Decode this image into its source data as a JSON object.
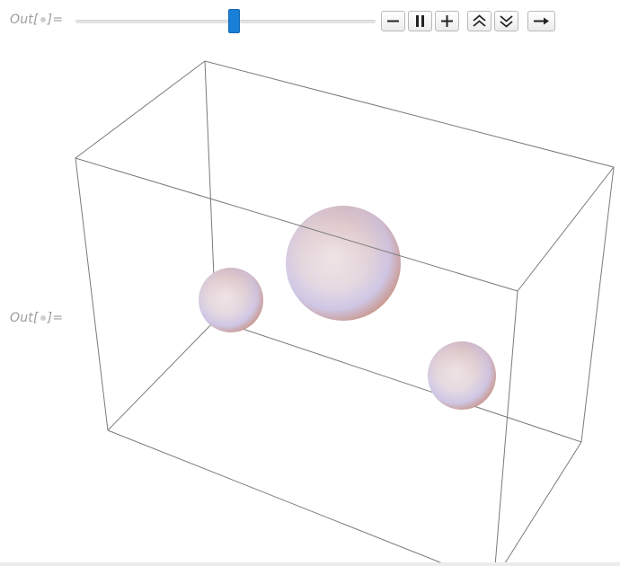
{
  "cells": [
    {
      "label_prefix": "Out[",
      "label_suffix": "]="
    },
    {
      "label_prefix": "Out[",
      "label_suffix": "]="
    }
  ],
  "manipulate": {
    "slider_value_fraction": 0.53,
    "controls": [
      {
        "name": "step-backward-button",
        "icon": "minus-icon"
      },
      {
        "name": "pause-button",
        "icon": "pause-icon"
      },
      {
        "name": "step-forward-button",
        "icon": "plus-icon"
      },
      {
        "name": "faster-button",
        "icon": "double-chevron-up-icon"
      },
      {
        "name": "slower-button",
        "icon": "double-chevron-down-icon"
      },
      {
        "name": "direction-button",
        "icon": "arrow-right-icon"
      }
    ]
  },
  "graphics3d": {
    "box_color": "#7a7a7a",
    "sphere_colors": {
      "base": "#e7dce3",
      "highlight": "#f6f0f4",
      "warm_shadow": "#c9978c",
      "cool_tint": "#cfc6e4"
    },
    "spheres": [
      {
        "name": "sphere-left"
      },
      {
        "name": "sphere-center"
      },
      {
        "name": "sphere-right"
      }
    ]
  }
}
